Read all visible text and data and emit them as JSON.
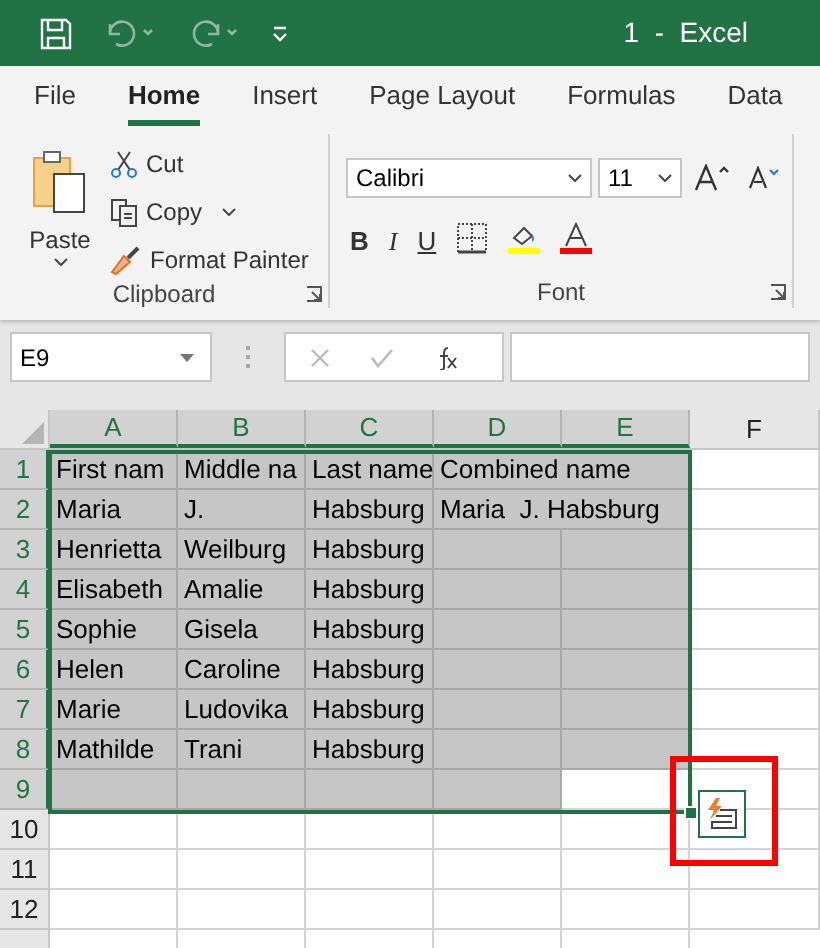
{
  "title_bar": {
    "title": "1  -  Excel"
  },
  "ribbon_tabs": [
    {
      "label": "File",
      "selected": false
    },
    {
      "label": "Home",
      "selected": true
    },
    {
      "label": "Insert",
      "selected": false
    },
    {
      "label": "Page Layout",
      "selected": false
    },
    {
      "label": "Formulas",
      "selected": false
    },
    {
      "label": "Data",
      "selected": false
    }
  ],
  "clipboard_group": {
    "paste": "Paste",
    "commands": [
      "Cut",
      "Copy",
      "Format Painter"
    ],
    "label": "Clipboard"
  },
  "font_group": {
    "font_name": "Calibri",
    "font_size": "11",
    "styles": [
      "B",
      "I",
      "U"
    ],
    "label": "Font"
  },
  "formula_bar": {
    "name_box": "E9"
  },
  "sheet": {
    "columns": [
      {
        "label": "A",
        "selected": true
      },
      {
        "label": "B",
        "selected": true
      },
      {
        "label": "C",
        "selected": true
      },
      {
        "label": "D",
        "selected": true
      },
      {
        "label": "E",
        "selected": true
      },
      {
        "label": "F",
        "selected": false
      }
    ],
    "rows": [
      {
        "label": "1",
        "selected": true,
        "cells": [
          {
            "text": "First nam",
            "selected": true
          },
          {
            "text": "Middle na",
            "selected": true
          },
          {
            "text": "Last name",
            "selected": true
          },
          {
            "text": "Combined name",
            "selected": true
          },
          {
            "selected": true
          },
          {
            "selected": false
          }
        ]
      },
      {
        "label": "2",
        "selected": true,
        "cells": [
          {
            "text": "Maria",
            "selected": true
          },
          {
            "text": "J.",
            "selected": true
          },
          {
            "text": "Habsburg",
            "selected": true
          },
          {
            "text": "Maria  J. Habsburg",
            "selected": true
          },
          {
            "selected": true
          },
          {
            "selected": false
          }
        ]
      },
      {
        "label": "3",
        "selected": true,
        "cells": [
          {
            "text": "Henrietta",
            "selected": true
          },
          {
            "text": "Weilburg",
            "selected": true
          },
          {
            "text": "Habsburg",
            "selected": true
          },
          {
            "selected": true
          },
          {
            "selected": true
          },
          {
            "selected": false
          }
        ]
      },
      {
        "label": "4",
        "selected": true,
        "cells": [
          {
            "text": "Elisabeth",
            "selected": true
          },
          {
            "text": "Amalie",
            "selected": true
          },
          {
            "text": "Habsburg",
            "selected": true
          },
          {
            "selected": true
          },
          {
            "selected": true
          },
          {
            "selected": false
          }
        ]
      },
      {
        "label": "5",
        "selected": true,
        "cells": [
          {
            "text": "Sophie",
            "selected": true
          },
          {
            "text": "Gisela",
            "selected": true
          },
          {
            "text": "Habsburg",
            "selected": true
          },
          {
            "selected": true
          },
          {
            "selected": true
          },
          {
            "selected": false
          }
        ]
      },
      {
        "label": "6",
        "selected": true,
        "cells": [
          {
            "text": "Helen",
            "selected": true
          },
          {
            "text": "Caroline",
            "selected": true
          },
          {
            "text": "Habsburg",
            "selected": true
          },
          {
            "selected": true
          },
          {
            "selected": true
          },
          {
            "selected": false
          }
        ]
      },
      {
        "label": "7",
        "selected": true,
        "cells": [
          {
            "text": "Marie",
            "selected": true
          },
          {
            "text": "Ludovika",
            "selected": true
          },
          {
            "text": "Habsburg",
            "selected": true
          },
          {
            "selected": true
          },
          {
            "selected": true
          },
          {
            "selected": false
          }
        ]
      },
      {
        "label": "8",
        "selected": true,
        "cells": [
          {
            "text": "Mathilde",
            "selected": true
          },
          {
            "text": "Trani",
            "selected": true
          },
          {
            "text": "Habsburg",
            "selected": true
          },
          {
            "selected": true
          },
          {
            "selected": true
          },
          {
            "selected": false
          }
        ]
      },
      {
        "label": "9",
        "selected": true,
        "cells": [
          {
            "selected": true
          },
          {
            "selected": true
          },
          {
            "selected": true
          },
          {
            "selected": true
          },
          {
            "selected": false
          },
          {
            "selected": false
          }
        ]
      },
      {
        "label": "10",
        "selected": false,
        "cells": [
          {
            "selected": false
          },
          {
            "selected": false
          },
          {
            "selected": false
          },
          {
            "selected": false
          },
          {
            "selected": false
          },
          {
            "selected": false
          }
        ]
      },
      {
        "label": "11",
        "selected": false,
        "cells": [
          {
            "selected": false
          },
          {
            "selected": false
          },
          {
            "selected": false
          },
          {
            "selected": false
          },
          {
            "selected": false
          },
          {
            "selected": false
          }
        ]
      },
      {
        "label": "12",
        "selected": false,
        "cells": [
          {
            "selected": false
          },
          {
            "selected": false
          },
          {
            "selected": false
          },
          {
            "selected": false
          },
          {
            "selected": false
          },
          {
            "selected": false
          }
        ]
      }
    ]
  }
}
